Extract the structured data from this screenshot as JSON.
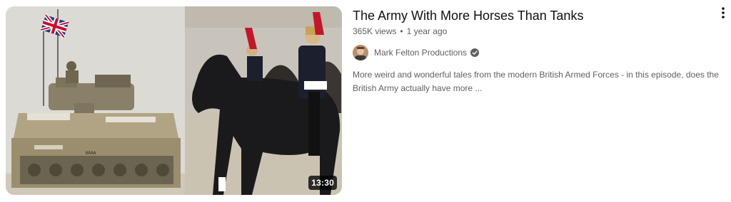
{
  "video": {
    "title": "The Army With More Horses Than Tanks",
    "views": "365K views",
    "separator": "•",
    "age": "1 year ago",
    "duration": "13:30",
    "channel_name": "Mark Felton Productions",
    "description": "More weird and wonderful tales from the modern British Armed Forces - in this episode, does the British Army actually have more ...",
    "tank_marking": "BRAA"
  },
  "icons": {
    "menu": "more-vert-icon",
    "verified": "check-circle-icon"
  },
  "colors": {
    "title": "#0f0f0f",
    "meta": "#606060",
    "duration_bg": "#000000"
  }
}
